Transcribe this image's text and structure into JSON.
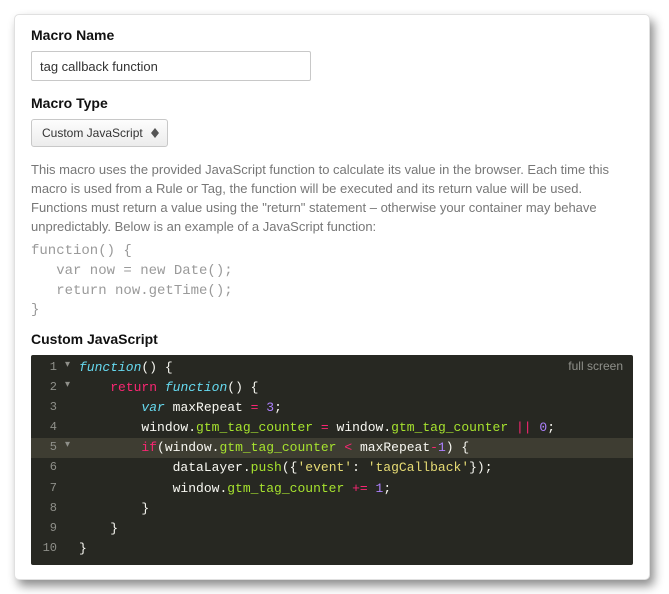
{
  "macro_name": {
    "label": "Macro Name",
    "value": "tag callback function"
  },
  "macro_type": {
    "label": "Macro Type",
    "selected": "Custom JavaScript"
  },
  "description": "This macro uses the provided JavaScript function to calculate its value in the browser. Each time this macro is used from a Rule or Tag, the function will be executed and its return value will be used. Functions must return a value using the \"return\" statement – otherwise your container may behave unpredictably. Below is an example of a JavaScript function:",
  "sample_code": "function() {\n   var now = new Date();\n   return now.getTime();\n}",
  "editor_label": "Custom JavaScript",
  "fullscreen_label": "full screen",
  "code": {
    "lines": [
      {
        "n": 1,
        "fold": true,
        "indent": 0,
        "tokens": [
          [
            "kw-blue",
            "function"
          ],
          [
            "punct",
            "() {"
          ]
        ]
      },
      {
        "n": 2,
        "fold": true,
        "indent": 1,
        "tokens": [
          [
            "kw-red",
            "return"
          ],
          [
            "punct",
            " "
          ],
          [
            "kw-blue",
            "function"
          ],
          [
            "punct",
            "() {"
          ]
        ]
      },
      {
        "n": 3,
        "fold": false,
        "indent": 2,
        "tokens": [
          [
            "storage",
            "var"
          ],
          [
            "punct",
            " "
          ],
          [
            "ident",
            "maxRepeat"
          ],
          [
            "punct",
            " "
          ],
          [
            "op",
            "="
          ],
          [
            "punct",
            " "
          ],
          [
            "num",
            "3"
          ],
          [
            "punct",
            ";"
          ]
        ]
      },
      {
        "n": 4,
        "fold": false,
        "indent": 2,
        "tokens": [
          [
            "ident",
            "window"
          ],
          [
            "punct",
            "."
          ],
          [
            "var-green",
            "gtm_tag_counter"
          ],
          [
            "punct",
            " "
          ],
          [
            "op",
            "="
          ],
          [
            "punct",
            " "
          ],
          [
            "ident",
            "window"
          ],
          [
            "punct",
            "."
          ],
          [
            "var-green",
            "gtm_tag_counter"
          ],
          [
            "punct",
            " "
          ],
          [
            "op",
            "||"
          ],
          [
            "punct",
            " "
          ],
          [
            "num",
            "0"
          ],
          [
            "punct",
            ";"
          ]
        ]
      },
      {
        "n": 5,
        "fold": true,
        "indent": 2,
        "active": true,
        "tokens": [
          [
            "kw-red",
            "if"
          ],
          [
            "punct",
            "("
          ],
          [
            "ident",
            "window"
          ],
          [
            "punct",
            "."
          ],
          [
            "var-green",
            "gtm_tag_counter"
          ],
          [
            "punct",
            " "
          ],
          [
            "op",
            "<"
          ],
          [
            "punct",
            " "
          ],
          [
            "ident",
            "maxRepeat"
          ],
          [
            "op",
            "-"
          ],
          [
            "num",
            "1"
          ],
          [
            "punct",
            ") {"
          ]
        ]
      },
      {
        "n": 6,
        "fold": false,
        "indent": 3,
        "tokens": [
          [
            "ident",
            "dataLayer"
          ],
          [
            "punct",
            "."
          ],
          [
            "var-green",
            "push"
          ],
          [
            "punct",
            "({"
          ],
          [
            "str",
            "'event'"
          ],
          [
            "punct",
            ": "
          ],
          [
            "str",
            "'tagCallback'"
          ],
          [
            "punct",
            "});"
          ]
        ]
      },
      {
        "n": 7,
        "fold": false,
        "indent": 3,
        "tokens": [
          [
            "ident",
            "window"
          ],
          [
            "punct",
            "."
          ],
          [
            "var-green",
            "gtm_tag_counter"
          ],
          [
            "punct",
            " "
          ],
          [
            "op",
            "+="
          ],
          [
            "punct",
            " "
          ],
          [
            "num",
            "1"
          ],
          [
            "punct",
            ";"
          ]
        ]
      },
      {
        "n": 8,
        "fold": false,
        "indent": 2,
        "tokens": [
          [
            "punct",
            "}"
          ]
        ]
      },
      {
        "n": 9,
        "fold": false,
        "indent": 1,
        "tokens": [
          [
            "punct",
            "}"
          ]
        ]
      },
      {
        "n": 10,
        "fold": false,
        "indent": 0,
        "tokens": [
          [
            "punct",
            "}"
          ]
        ]
      }
    ]
  }
}
